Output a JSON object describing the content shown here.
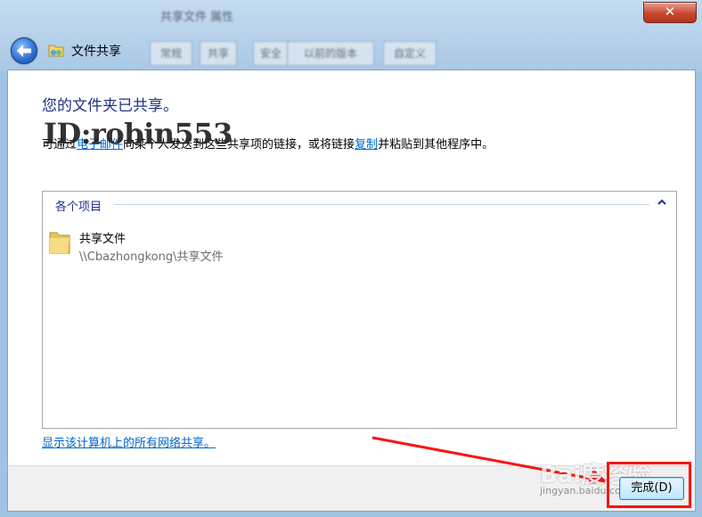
{
  "window": {
    "bg_title": "共享文件 属性",
    "bg_tabs": [
      "常规",
      "共享",
      "安全",
      "以前的版本",
      "自定义"
    ],
    "close_label": "✕"
  },
  "header": {
    "title": "文件共享"
  },
  "main": {
    "heading": "您的文件夹已共享。",
    "desc_prefix": "可通过",
    "desc_link1": "电子邮件",
    "desc_middle": "向某个人发送到这些共享项的链接，或将链接",
    "desc_link2": "复制",
    "desc_suffix": "并粘贴到其他程序中。",
    "watermark": "ID:robin553"
  },
  "items": {
    "group_label": "各个项目",
    "list": [
      {
        "name": "共享文件",
        "path": "\\\\Cbazhongkong\\共享文件"
      }
    ]
  },
  "footer": {
    "link": "显示该计算机上的所有网络共享。",
    "done_label": "完成(D)"
  },
  "overlay": {
    "baidu": "Bai度经验",
    "baidu_sub": "jingyan.baidu.com"
  },
  "colors": {
    "heading": "#1e3287",
    "link": "#0066cc",
    "highlight": "#ff1111"
  }
}
